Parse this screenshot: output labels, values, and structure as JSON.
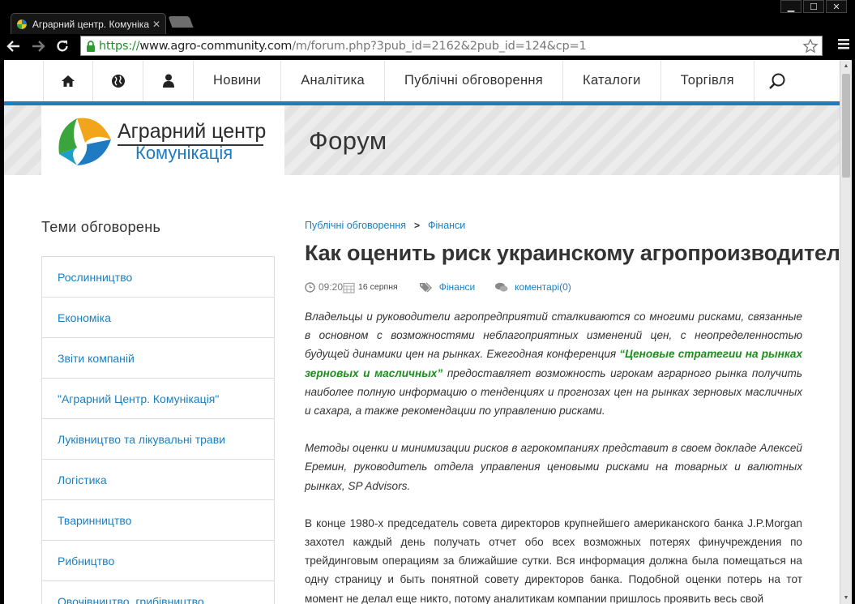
{
  "browser": {
    "tab_title": "Аграрний центр. Комунікац",
    "url_scheme": "https://",
    "url_host": "www.agro-community.com",
    "url_path": "/m/forum.php?3pub_id=2162&2pub_id=124&cp=1"
  },
  "nav": {
    "items": [
      "Новини",
      "Аналітика",
      "Публічні обговорення",
      "Каталоги",
      "Торгівля"
    ]
  },
  "brand": {
    "line1": "Аграрний центр",
    "line2": "Комунікація"
  },
  "banner_title": "Форум",
  "sidebar": {
    "heading": "Теми обговорень",
    "topics": [
      "Рослинництво",
      "Економіка",
      "Звіти компаній",
      "\"Аграрний Центр. Комунікація\"",
      "Луківництво та лікувальні трави",
      "Логістика",
      "Тваринництво",
      "Рибництво",
      "Овочівництво, грибівництво"
    ]
  },
  "article": {
    "crumb_1": "Публічні обговорення",
    "crumb_2": "Фінанси",
    "title": "Как оценить риск украинскому агропроизводителю?",
    "time": "09:20",
    "date": "16 серпня",
    "category": "Фінанси",
    "comments": "коментарі(0)",
    "p1_a": "Владельцы и руководители агропредприятий сталкиваются со многими рисками, связанные в основном с возможностями неблагоприятных изменений цен, с неопределенностью будущей динамики цен на рынках. Ежегодная конференция ",
    "p1_link": "“Ценовые стратегии на рынках зерновых и масличных”",
    "p1_b": " предоставляет возможность игрокам аграрного рынка получить наиболее полную информацию о тенденциях и прогнозах цен на рынках зерновых масличных и сахара, а также рекомендации по управлению рисками.",
    "p2": "Методы оценки и минимизации рисков в агрокомпаниях представит в своем докладе Алексей Еремин, руководитель отдела управления ценовыми рисками на товарных и валютных рынках, SP Advisors.",
    "p3": "В конце 1980-х председатель совета директоров крупнейшего американского банка J.P.Morgan захотел каждый день получать отчет обо всех возможных потерях финучреждения по трейдинговым операциям за ближайшие сутки. Вся информация должна была помещаться на одну страницу и быть понятной совету директоров банка.   Подобной оценки потерь на тот момент не делал еще никто, потому аналитикам компании пришлось проявить весь свой"
  }
}
